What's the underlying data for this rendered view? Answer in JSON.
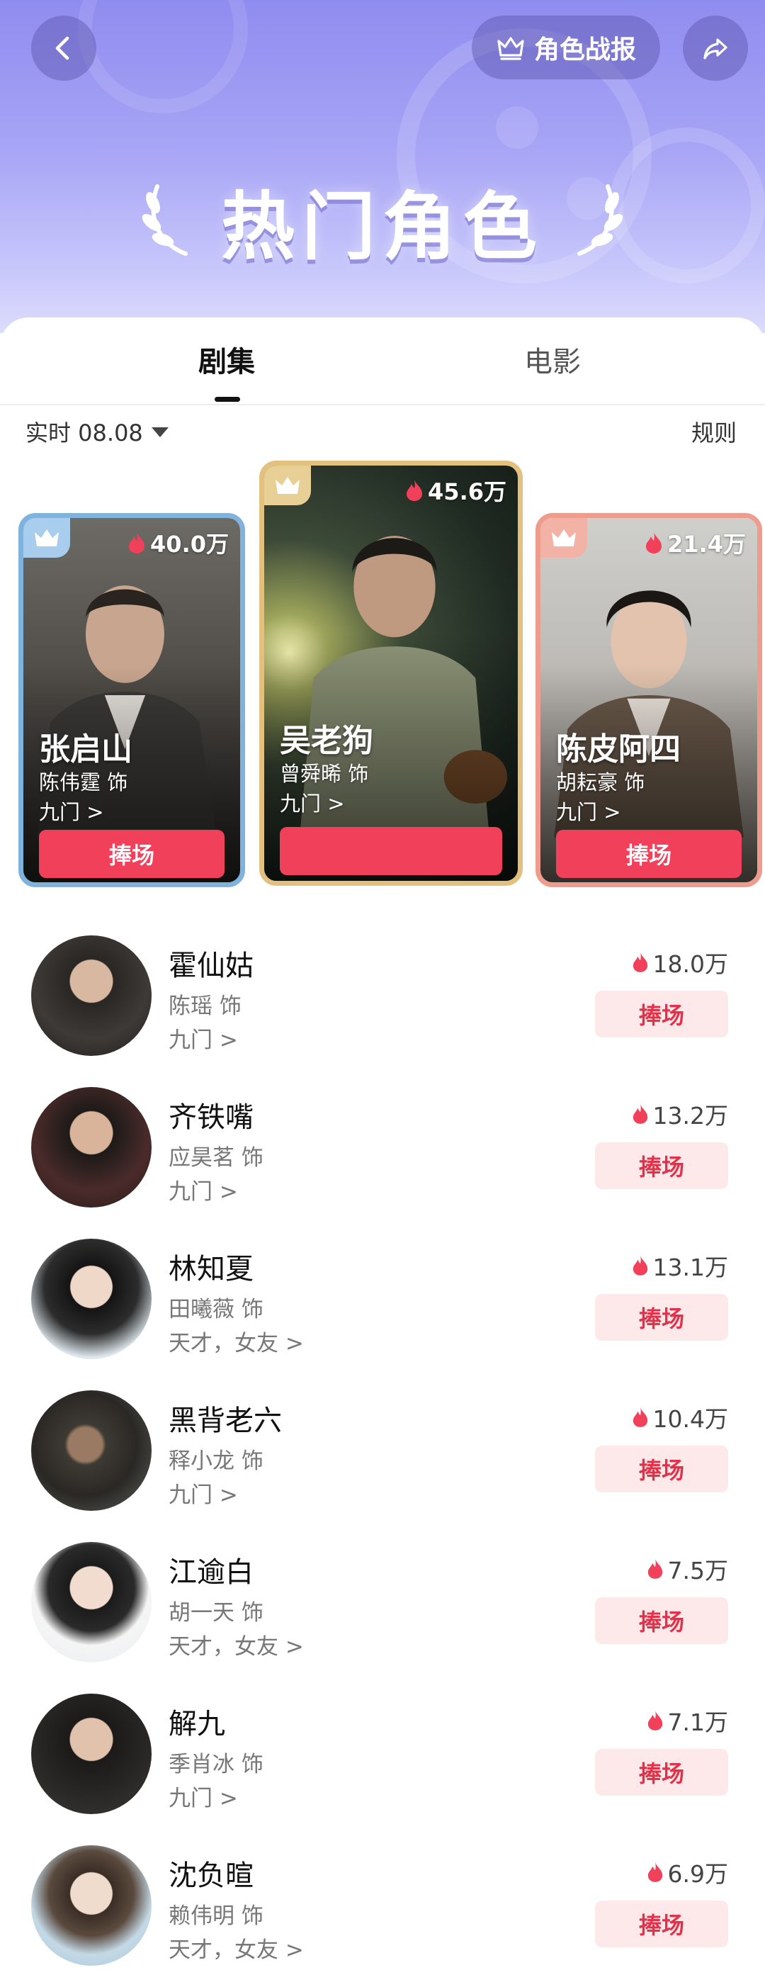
{
  "header": {
    "report_label": "角色战报",
    "title": "热门角色"
  },
  "tabs": [
    {
      "label": "剧集",
      "active": true
    },
    {
      "label": "电影",
      "active": false
    }
  ],
  "filter": {
    "realtime_label": "实时 08.08",
    "rules_label": "规则"
  },
  "top3": [
    {
      "rank": 2,
      "name": "张启山",
      "actor": "陈伟霆 饰",
      "drama": "九门 >",
      "heat": "40.0万",
      "button": "捧场",
      "frame_color": "#7fb2dd"
    },
    {
      "rank": 1,
      "name": "吴老狗",
      "actor": "曾舜晞 饰",
      "drama": "九门 >",
      "heat": "45.6万",
      "button": "",
      "frame_color": "#e2c07e"
    },
    {
      "rank": 3,
      "name": "陈皮阿四",
      "actor": "胡耘豪 饰",
      "drama": "九门 >",
      "heat": "21.4万",
      "button": "捧场",
      "frame_color": "#ee9c8e"
    }
  ],
  "list": [
    {
      "name": "霍仙姑",
      "actor": "陈瑶 饰",
      "drama": "九门 >",
      "heat": "18.0万",
      "button": "捧场"
    },
    {
      "name": "齐铁嘴",
      "actor": "应昊茗 饰",
      "drama": "九门 >",
      "heat": "13.2万",
      "button": "捧场"
    },
    {
      "name": "林知夏",
      "actor": "田曦薇 饰",
      "drama": "天才，女友 >",
      "heat": "13.1万",
      "button": "捧场"
    },
    {
      "name": "黑背老六",
      "actor": "释小龙 饰",
      "drama": "九门 >",
      "heat": "10.4万",
      "button": "捧场"
    },
    {
      "name": "江逾白",
      "actor": "胡一天 饰",
      "drama": "天才，女友 >",
      "heat": "7.5万",
      "button": "捧场"
    },
    {
      "name": "解九",
      "actor": "季肖冰 饰",
      "drama": "九门 >",
      "heat": "7.1万",
      "button": "捧场"
    },
    {
      "name": "沈负暄",
      "actor": "赖伟明 饰",
      "drama": "天才，女友 >",
      "heat": "6.9万",
      "button": "捧场"
    }
  ],
  "colors": {
    "accent": "#f0405a",
    "hero_bg": "#9d9af3",
    "button_soft_bg": "#fde8ea"
  },
  "icons": [
    "back-icon",
    "crown-icon",
    "share-icon",
    "laurel-icon",
    "flame-icon",
    "caret-down-icon"
  ]
}
